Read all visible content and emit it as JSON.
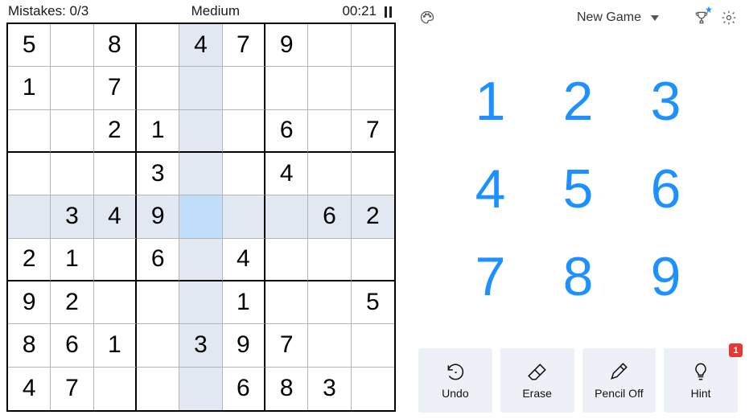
{
  "status": {
    "mistakes_label": "Mistakes: 0/3",
    "difficulty": "Medium",
    "timer": "00:21"
  },
  "board": [
    [
      "5",
      "",
      "8",
      "",
      "4",
      "7",
      "9",
      "",
      ""
    ],
    [
      "1",
      "",
      "7",
      "",
      "",
      "",
      "",
      "",
      ""
    ],
    [
      "",
      "",
      "2",
      "1",
      "",
      "",
      "6",
      "",
      "7"
    ],
    [
      "",
      "",
      "",
      "3",
      "",
      "",
      "4",
      "",
      ""
    ],
    [
      "",
      "3",
      "4",
      "9",
      "",
      "",
      "",
      "6",
      "2"
    ],
    [
      "2",
      "1",
      "",
      "6",
      "",
      "4",
      "",
      "",
      ""
    ],
    [
      "9",
      "2",
      "",
      "",
      "",
      "1",
      "",
      "",
      "5"
    ],
    [
      "8",
      "6",
      "1",
      "",
      "3",
      "9",
      "7",
      "",
      ""
    ],
    [
      "4",
      "7",
      "",
      "",
      "",
      "6",
      "8",
      "3",
      ""
    ]
  ],
  "selected": {
    "row": 4,
    "col": 4
  },
  "topbar": {
    "new_game_label": "New Game"
  },
  "numpad": [
    "1",
    "2",
    "3",
    "4",
    "5",
    "6",
    "7",
    "8",
    "9"
  ],
  "actions": {
    "undo": "Undo",
    "erase": "Erase",
    "pencil": "Pencil Off",
    "hint": "Hint",
    "hint_badge": "1"
  }
}
